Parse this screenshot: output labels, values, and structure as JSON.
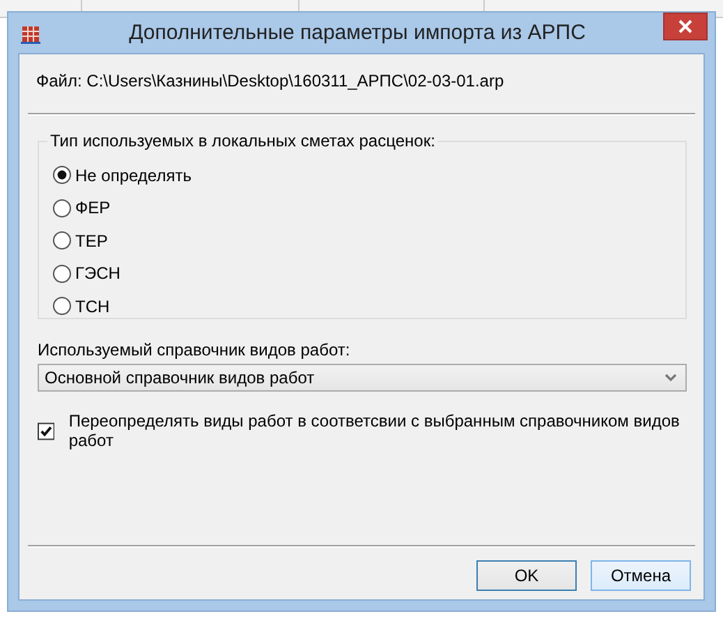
{
  "window": {
    "title": "Дополнительные параметры импорта из АРПС"
  },
  "file_label": "Файл: C:\\Users\\Казнины\\Desktop\\160311_АРПС\\02-03-01.arp",
  "rate_type_group": {
    "title": "Тип используемых в локальных сметах расценок:",
    "options": [
      {
        "label": "Не определять",
        "selected": true
      },
      {
        "label": "ФЕР",
        "selected": false
      },
      {
        "label": "ТЕР",
        "selected": false
      },
      {
        "label": "ГЭСН",
        "selected": false
      },
      {
        "label": "ТСН",
        "selected": false
      }
    ]
  },
  "work_types": {
    "label": "Используемый справочник видов работ:",
    "value": "Основной справочник видов работ"
  },
  "override_checkbox": {
    "label": "Переопределять виды работ в соответсвии с выбранным справочником видов работ",
    "checked": true
  },
  "buttons": [
    {
      "label": "OK",
      "kind": "default"
    },
    {
      "label": "Отмена",
      "kind": "hover"
    }
  ]
}
